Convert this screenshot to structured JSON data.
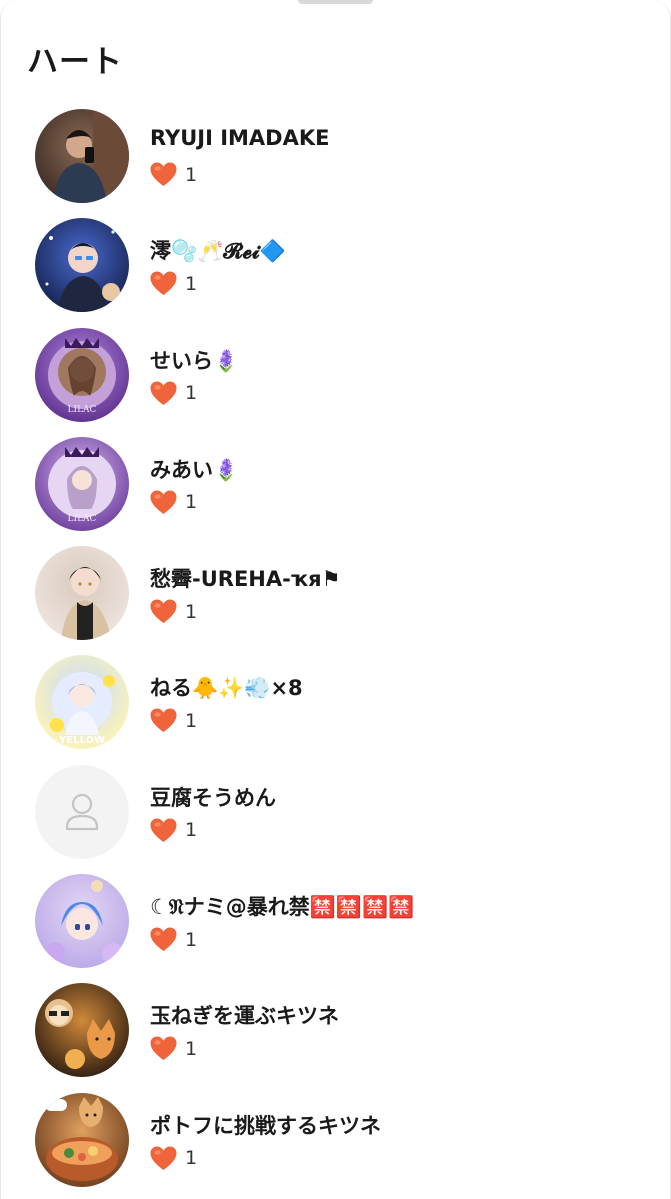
{
  "header": {
    "title": "ハート"
  },
  "colors": {
    "heart": "#f0643c",
    "heart_shine": "#ff9a72"
  },
  "users": [
    {
      "name": "RYUJI IMADAKE",
      "likes": "1",
      "avatar": "photo-man-mirror",
      "bg": [
        "#3a2a22",
        "#8a6a55"
      ]
    },
    {
      "name": "澪🫧🥂𝓡𝓮𝓲🔷",
      "likes": "1",
      "avatar": "anime-boy-blue-night",
      "bg": [
        "#14204a",
        "#4a6ad0"
      ]
    },
    {
      "name": "せいら🪻",
      "likes": "1",
      "avatar": "lilac-frame-photo",
      "bg": [
        "#5a2d8a",
        "#b48ae0"
      ]
    },
    {
      "name": "みあい🪻",
      "likes": "1",
      "avatar": "lilac-frame-anime-girl",
      "bg": [
        "#6a3a9a",
        "#d4b8f0"
      ]
    },
    {
      "name": "愁霽-UREHA-ҡя⚑",
      "likes": "1",
      "avatar": "anime-boy-beige",
      "bg": [
        "#efe6e0",
        "#d8c9bd"
      ]
    },
    {
      "name": "ねる🐥✨💨×8",
      "likes": "1",
      "avatar": "yellow-chick-anime",
      "bg": [
        "#fff6b0",
        "#c8d8ff"
      ]
    },
    {
      "name": "豆腐そうめん",
      "likes": "1",
      "avatar": "default-person",
      "bg": [
        "#f4f4f4",
        "#f4f4f4"
      ]
    },
    {
      "name": "☾𝔑ナミ@暴れ禁🈲🈲🈲🈲",
      "likes": "1",
      "avatar": "anime-blue-hair-purple",
      "bg": [
        "#b9a8e6",
        "#e3d6f5"
      ]
    },
    {
      "name": "玉ねぎを運ぶキツネ",
      "likes": "1",
      "avatar": "fox-onion-orange",
      "bg": [
        "#2a1a10",
        "#d08a3a"
      ]
    },
    {
      "name": "ポトフに挑戦するキツネ",
      "likes": "1",
      "avatar": "fox-pot-au-feu",
      "bg": [
        "#6a3a1a",
        "#e0a060"
      ]
    }
  ]
}
